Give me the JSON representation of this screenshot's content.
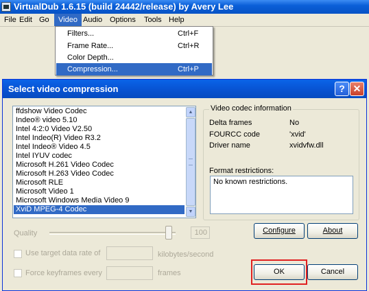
{
  "window": {
    "title": "VirtualDub 1.6.15 (build 24442/release) by Avery Lee"
  },
  "menubar": {
    "items": [
      "File",
      "Edit",
      "Go",
      "Video",
      "Audio",
      "Options",
      "Tools",
      "Help"
    ]
  },
  "video_menu": {
    "items": [
      {
        "label": "Filters...",
        "accelerator": "Ctrl+F"
      },
      {
        "label": "Frame Rate...",
        "accelerator": "Ctrl+R"
      },
      {
        "label": "Color Depth...",
        "accelerator": ""
      },
      {
        "label": "Compression...",
        "accelerator": "Ctrl+P"
      }
    ]
  },
  "dialog": {
    "title": "Select video compression",
    "help_glyph": "?",
    "close_glyph": "✕",
    "codecs": [
      "ffdshow Video Codec",
      "Indeo® video 5.10",
      "Intel 4:2:0 Video V2.50",
      "Intel Indeo(R) Video R3.2",
      "Intel Indeo® Video 4.5",
      "Intel IYUV codec",
      "Microsoft H.261 Video Codec",
      "Microsoft H.263 Video Codec",
      "Microsoft RLE",
      "Microsoft Video 1",
      "Microsoft Windows Media Video 9",
      "XviD MPEG-4 Codec"
    ],
    "selected_codec_index": 11,
    "info": {
      "legend": "Video codec information",
      "delta_label": "Delta frames",
      "delta_value": "No",
      "fourcc_label": "FOURCC code",
      "fourcc_value": "'xvid'",
      "driver_label": "Driver name",
      "driver_value": "xvidvfw.dll",
      "format_label": "Format restrictions:",
      "format_value": "No known restrictions."
    },
    "quality": {
      "label": "Quality",
      "value": "100"
    },
    "configure_label": "Configure",
    "about_label": "About",
    "target_rate_label": "Use target data rate of",
    "target_rate_unit": "kilobytes/second",
    "keyframes_label": "Force keyframes every",
    "keyframes_unit": "frames",
    "ok_label": "OK",
    "cancel_label": "Cancel",
    "highlight_color": "#e02020",
    "selection_color": "#316ac5"
  }
}
